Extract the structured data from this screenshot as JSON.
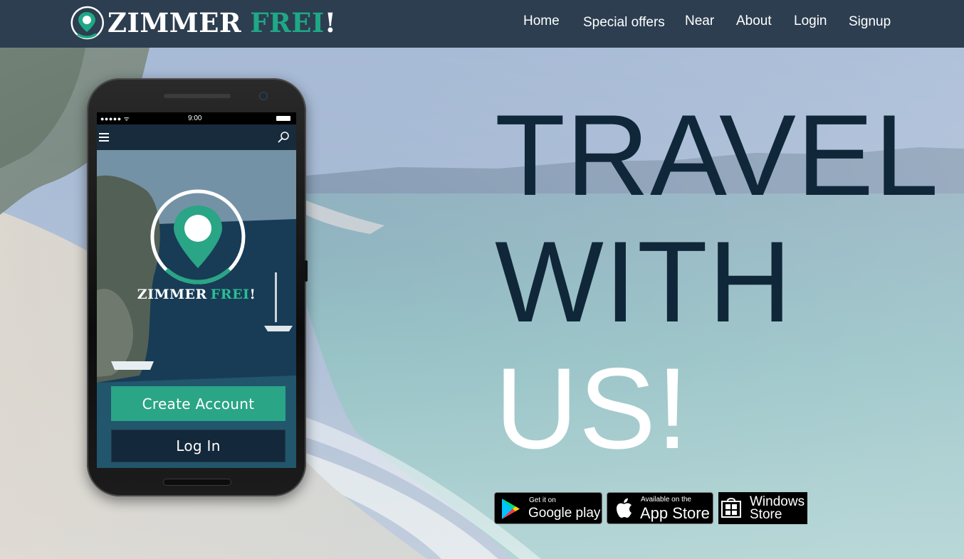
{
  "header": {
    "logo_word1": "ZIMMER",
    "logo_word2": "FREI",
    "logo_bang": "!",
    "nav": [
      "Home",
      "Special offers",
      "Near",
      "About",
      "Login",
      "Signup"
    ]
  },
  "phone": {
    "status_time": "9:00",
    "status_signal": "●●●●● ᯤ",
    "logo_word1": "ZIMMER",
    "logo_word2": "FREI",
    "logo_bang": "!",
    "create_account": "Create Account",
    "log_in": "Log In"
  },
  "headline": {
    "line1": "TRAVEL",
    "line2": "WITH",
    "line3": "US!"
  },
  "stores": {
    "google_small": "Get it on",
    "google_big": "Google play",
    "apple_small": "Available on the",
    "apple_big": "App Store",
    "windows_line1": "Windows",
    "windows_line2": "Store"
  },
  "colors": {
    "header_bg": "#2c3e50",
    "brand_green": "#1fa886",
    "headline_dark": "#10273a",
    "login_button": "#13283a"
  }
}
